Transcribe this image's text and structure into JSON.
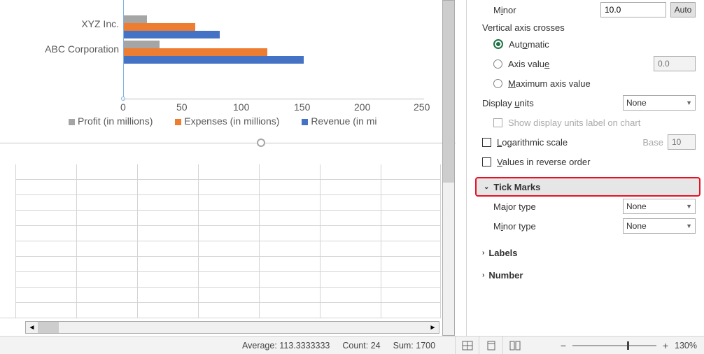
{
  "chart_data": {
    "type": "bar",
    "orientation": "horizontal",
    "categories": [
      "ABC Corporation",
      "XYZ Inc."
    ],
    "series": [
      {
        "name": "Revenue (in millions)",
        "values": [
          150,
          80
        ],
        "color": "#4472C4"
      },
      {
        "name": "Expenses (in millions)",
        "values": [
          120,
          60
        ],
        "color": "#ED7D31"
      },
      {
        "name": "Profit (in millions)",
        "values": [
          30,
          20
        ],
        "color": "#A5A5A5"
      }
    ],
    "xlabel": "",
    "ylabel": "",
    "xlim": [
      0,
      250
    ],
    "x_ticks": [
      0,
      50,
      100,
      150,
      200,
      250
    ]
  },
  "chart_legend_truncated": "Revenue (in mi",
  "panel": {
    "minor_label": "Minor",
    "minor_value": "10.0",
    "auto_label": "Auto",
    "vac_title": "Vertical axis crosses",
    "vac_automatic": "Automatic",
    "vac_axis_value_label": "Axis value",
    "vac_axis_value_placeholder": "0.0",
    "vac_max_label": "Maximum axis value",
    "display_units_label": "Display units",
    "display_units_value": "None",
    "show_units_label": "Show display units label on chart",
    "log_label": "Logarithmic scale",
    "log_base_label": "Base",
    "log_base_value": "10",
    "reverse_label": "Values in reverse order",
    "tick_marks_header": "Tick Marks",
    "major_type_label": "Major type",
    "major_type_value": "None",
    "minor_type_label": "Minor type",
    "minor_type_value": "None",
    "labels_header": "Labels",
    "number_header": "Number"
  },
  "status": {
    "average_label": "Average:",
    "average_value": "113.3333333",
    "count_label": "Count:",
    "count_value": "24",
    "sum_label": "Sum:",
    "sum_value": "1700",
    "zoom": "130%"
  }
}
